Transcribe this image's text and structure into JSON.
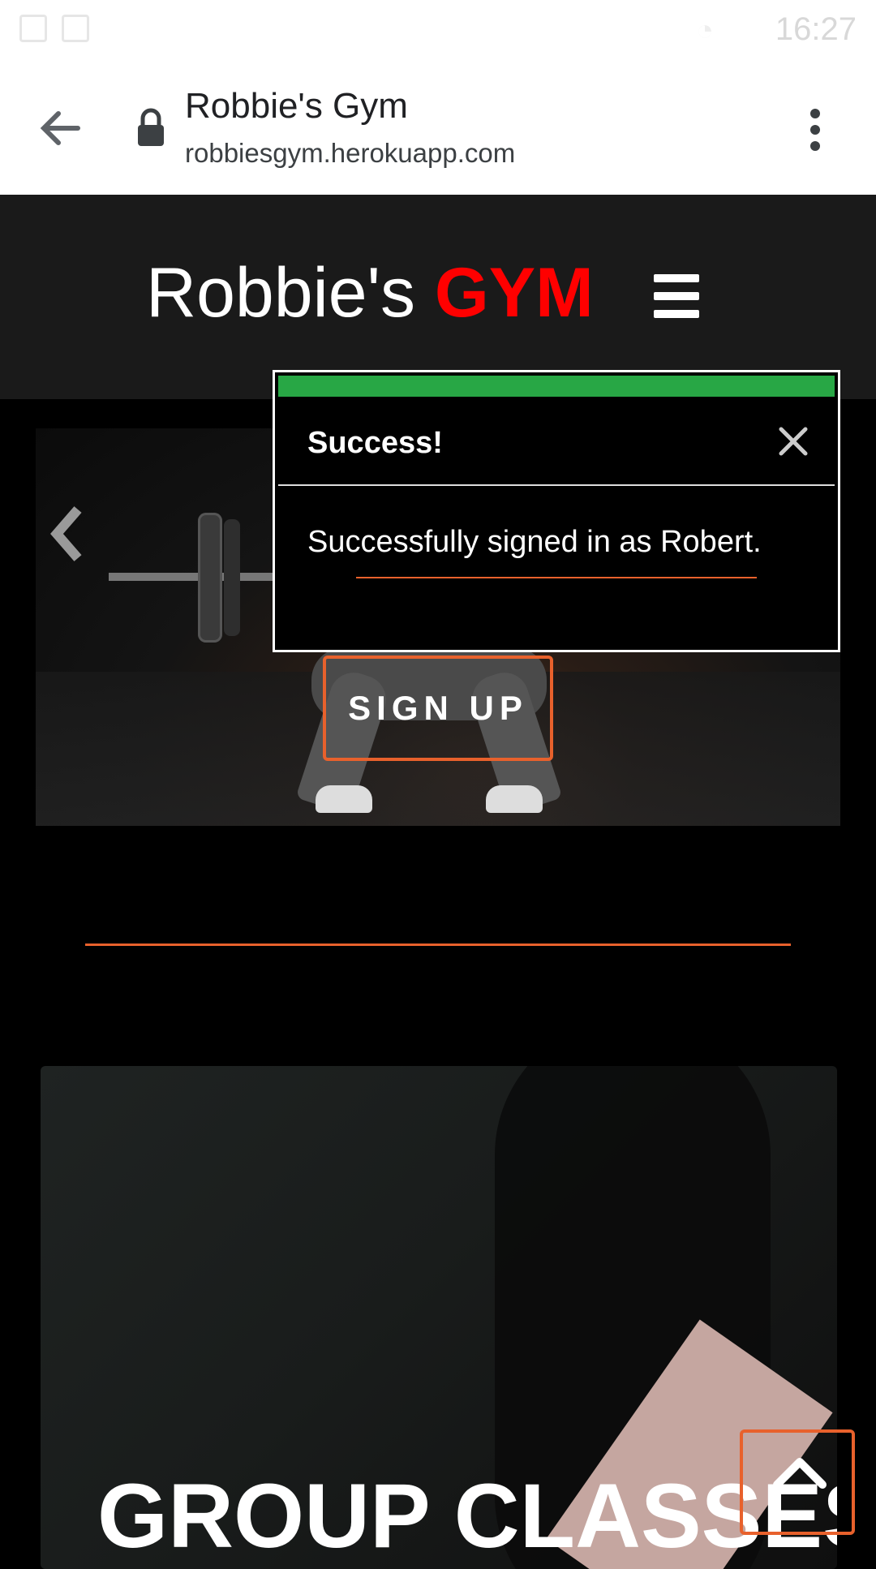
{
  "status_bar": {
    "time": "16:27"
  },
  "browser": {
    "title": "Robbie's Gym",
    "url": "robbiesgym.herokuapp.com"
  },
  "header": {
    "brand_main": "Robbie's ",
    "brand_accent": "GYM"
  },
  "hero": {
    "cta_label": "SIGN UP"
  },
  "toast": {
    "title": "Success!",
    "message": "Successfully signed in as Robert.",
    "accent_color": "#28a745"
  },
  "section": {
    "heading": "GROUP CLASSES"
  },
  "colors": {
    "brand_red": "#ff0000",
    "accent_orange": "#e8612c"
  }
}
